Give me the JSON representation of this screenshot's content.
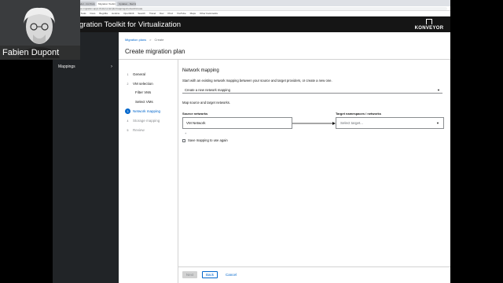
{
  "browser": {
    "tabs": [
      "Fedor - Inc Pod deploy",
      "Migration Toolkit for V",
      "Updates - Red Hat Issue"
    ],
    "url": "virt-konveyor-migration.apps.cluster.example/mappings/network/create",
    "bookmarks": [
      "Apps",
      "Tech triage",
      "Tools",
      "Docs",
      "Bugzilla",
      "Jenkins",
      "OpenShift",
      "Search",
      "Travel",
      "Dev",
      "Prod",
      "YouTube",
      "Maps",
      "Other bookmarks"
    ]
  },
  "app": {
    "title": "Migration Toolkit for Virtualization",
    "logo_text": "KONVEYOR"
  },
  "nav": {
    "mappings_label": "Mappings"
  },
  "breadcrumb": {
    "parent": "Migration plans",
    "separator": ">",
    "current": "Create"
  },
  "page": {
    "title": "Create migration plan"
  },
  "wizard": {
    "steps": [
      {
        "num": "1",
        "label": "General"
      },
      {
        "num": "2",
        "label": "VM selection"
      },
      {
        "num": "3",
        "label": "Network mapping"
      },
      {
        "num": "4",
        "label": "Storage mapping"
      },
      {
        "num": "5",
        "label": "Review"
      }
    ],
    "substeps": [
      "Filter VMs",
      "Select VMs"
    ]
  },
  "network_mapping": {
    "section_title": "Network mapping",
    "description": "Start with an existing network mapping between your source and target providers, or create a new one.",
    "select_value": "Create a new network mapping",
    "instructions": "Map source and target networks.",
    "source_label": "Source networks",
    "target_label": "Target namespaces / networks",
    "source_value": "VM Network",
    "target_placeholder": "Select target...",
    "add_symbol": "+",
    "save_label": "Save mapping to use again"
  },
  "footer": {
    "next": "Next",
    "back": "Back",
    "cancel": "Cancel"
  },
  "webcam": {
    "name": "Fabien Dupont"
  },
  "colors": {
    "masthead": "#151515",
    "nav": "#212427",
    "link": "#0066cc"
  }
}
